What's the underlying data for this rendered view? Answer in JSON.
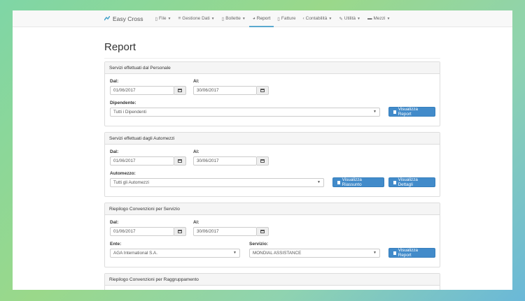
{
  "nav": {
    "brand": "Easy Cross",
    "items": [
      {
        "label": "File",
        "icon": "file-icon",
        "caret": true
      },
      {
        "label": "Gestione Dati",
        "icon": "database-icon",
        "caret": true
      },
      {
        "label": "Bollette",
        "icon": "document-icon",
        "caret": true
      },
      {
        "label": "Report",
        "icon": "pie-chart-icon",
        "caret": false,
        "active": true
      },
      {
        "label": "Fatture",
        "icon": "document-icon",
        "caret": false
      },
      {
        "label": "Contabilità",
        "icon": "chevron-left-icon",
        "caret": true
      },
      {
        "label": "Utilità",
        "icon": "wrench-icon",
        "caret": true
      },
      {
        "label": "Mezzi",
        "icon": "truck-icon",
        "caret": true
      }
    ]
  },
  "page_title": "Report",
  "panels": [
    {
      "title": "Servizi effettuati dal Personale",
      "dal_label": "Dal:",
      "dal_value": "01/06/2017",
      "al_label": "Al:",
      "al_value": "30/06/2017",
      "select_label": "Dipendente:",
      "select_value": "Tutti i Dipendenti",
      "button": "Visualizza Report"
    },
    {
      "title": "Servizi effettuati dagli Automezzi",
      "dal_label": "Dal:",
      "dal_value": "01/06/2017",
      "al_label": "Al:",
      "al_value": "30/06/2017",
      "select_label": "Automezzo:",
      "select_value": "Tutti gli Automezzi",
      "button": "Visualizza Riassunto",
      "button2": "Visualizza Dettagli"
    },
    {
      "title": "Riepilogo Convenzioni per Servizio",
      "dal_label": "Dal:",
      "dal_value": "01/06/2017",
      "al_label": "Al:",
      "al_value": "30/06/2017",
      "select_label": "Ente:",
      "select_value": "AGA International S.A.",
      "select2_label": "Servizio:",
      "select2_value": "MONDIAL ASSISTANCE",
      "button": "Visualizza Report"
    },
    {
      "title": "Riepilogo Convenzioni per Raggruppamento"
    }
  ],
  "colors": {
    "primary": "#428bca",
    "active_underline": "#5aa9cf"
  }
}
